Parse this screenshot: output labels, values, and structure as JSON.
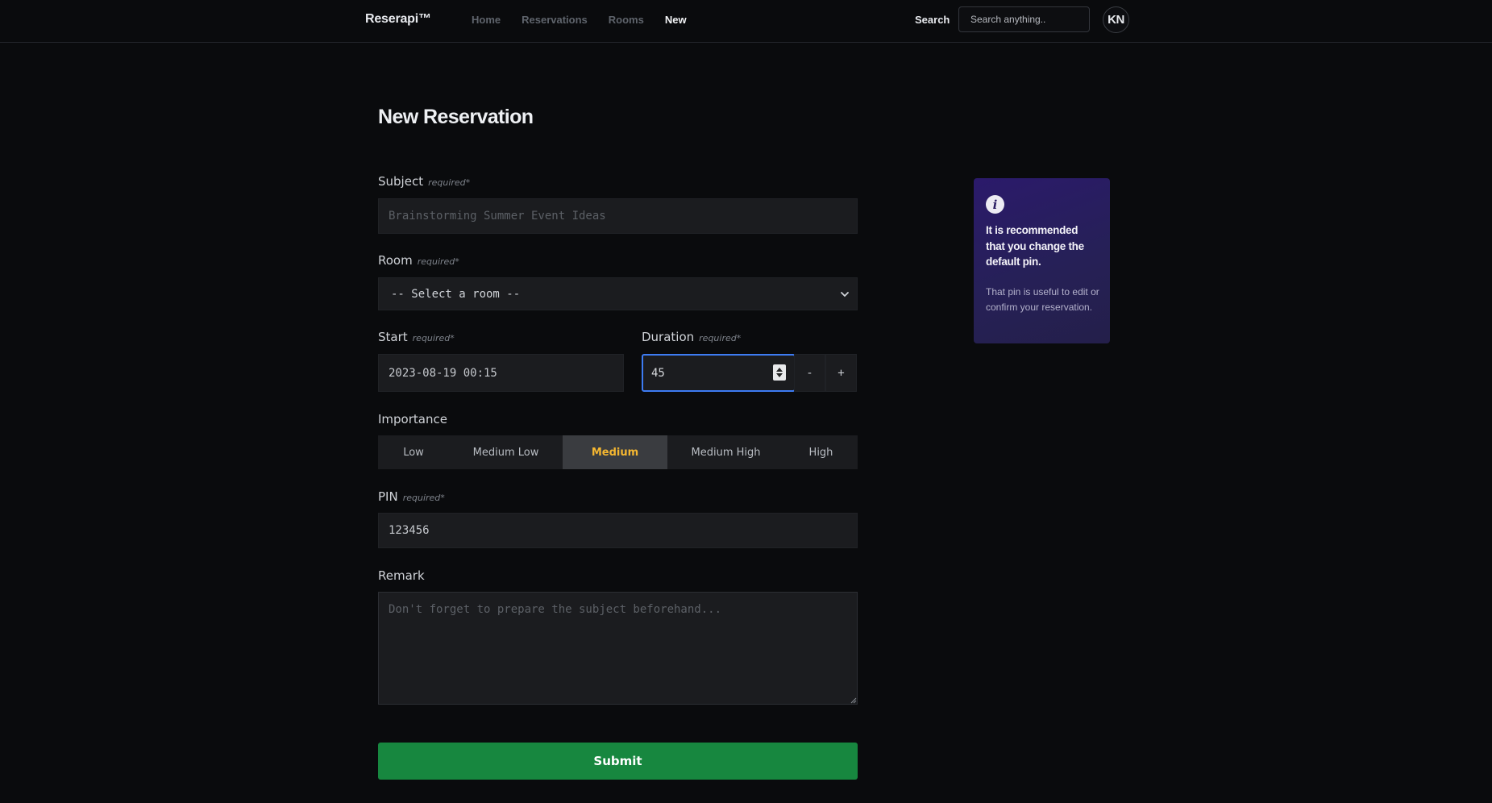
{
  "nav": {
    "brand": "Reserapi™",
    "links": [
      {
        "label": "Home",
        "active": false
      },
      {
        "label": "Reservations",
        "active": false
      },
      {
        "label": "Rooms",
        "active": false
      },
      {
        "label": "New",
        "active": true
      }
    ],
    "search_label": "Search",
    "search_placeholder": "Search anything..",
    "avatar_initials": "KN"
  },
  "form": {
    "title": "New Reservation",
    "required_tag": "required*",
    "subject": {
      "label": "Subject",
      "placeholder": "Brainstorming Summer Event Ideas",
      "value": ""
    },
    "room": {
      "label": "Room",
      "selected": "-- Select a room --"
    },
    "start": {
      "label": "Start",
      "value": "2023-08-19 00:15"
    },
    "duration": {
      "label": "Duration",
      "value": "45",
      "decrement": "-",
      "increment": "+"
    },
    "importance": {
      "label": "Importance",
      "options": [
        "Low",
        "Medium Low",
        "Medium",
        "Medium High",
        "High"
      ],
      "selected": "Medium"
    },
    "pin": {
      "label": "PIN",
      "value": "123456"
    },
    "remark": {
      "label": "Remark",
      "placeholder": "Don't forget to prepare the subject beforehand..."
    },
    "submit_label": "Submit"
  },
  "info_card": {
    "icon": "info-icon",
    "icon_glyph": "i",
    "heading": "It is recommended that you change the default pin.",
    "body": "That pin is useful to edit or confirm your reservation."
  },
  "colors": {
    "background": "#0a0b0d",
    "accent_focus": "#3d7bf2",
    "selected_importance": "#f5b731",
    "submit": "#17873f",
    "info_card": "#2b1a6b"
  }
}
